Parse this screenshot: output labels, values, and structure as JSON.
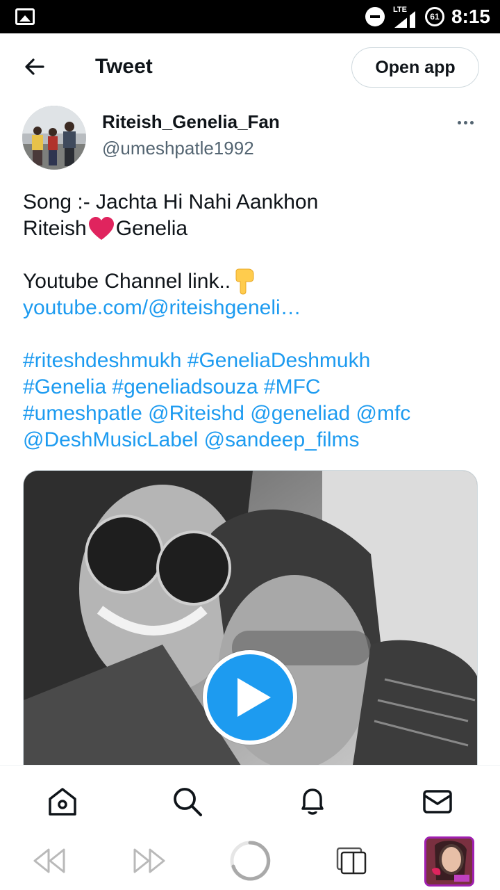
{
  "status_bar": {
    "network": "LTE",
    "battery": "61",
    "time": "8:15",
    "icons": [
      "gallery-notification-icon",
      "do-not-disturb-icon",
      "lte-signal-icon",
      "battery-icon"
    ]
  },
  "header": {
    "title": "Tweet",
    "open_app_label": "Open app"
  },
  "author": {
    "name": "Riteish_Genelia_Fan",
    "handle": "@umeshpatle1992"
  },
  "tweet": {
    "line1": "Song :- Jachta Hi Nahi Aankhon",
    "line2_a": "Riteish",
    "line2_b": "Genelia",
    "line3": "Youtube Channel link..",
    "link": "youtube.com/@riteishgeneli…",
    "tags_line1": "#riteshdeshmukh #GeneliaDeshmukh",
    "tags_line2": "#Genelia #geneliadsouza #MFC",
    "tags_line3": "#umeshpatle @Riteishd @geneliad @mfc",
    "tags_line4": "@DeshMusicLabel @sandeep_films"
  },
  "colors": {
    "link": "#1d9bf0",
    "text": "#0f1419",
    "secondary": "#536471",
    "heart": "#e0245e"
  },
  "bottom_nav": [
    "home-icon",
    "search-icon",
    "notifications-icon",
    "messages-icon"
  ],
  "browser_bar": [
    "rewind-icon",
    "forward-icon",
    "loading-icon",
    "tabs-icon",
    "tab-thumbnail"
  ]
}
